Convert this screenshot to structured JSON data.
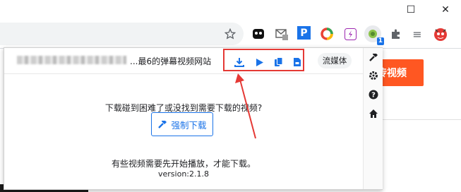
{
  "window": {
    "restore_glyph": "☐",
    "close_glyph": "✕"
  },
  "popup": {
    "title": "...最6的弹幕视频网站",
    "stream_label": "流媒体",
    "message": "下载碰到困难了或没找到需要下载的视频?",
    "force_download_label": "强制下载",
    "note": "有些视频需要先开始播放，才能下载。",
    "version": "version:2.1.8"
  },
  "page": {
    "orange_button_label": "传视频"
  },
  "extensions": {
    "badge_count": "1",
    "p_letter": "P",
    "reading_list_glyph": "≡"
  },
  "colors": {
    "accent": "#1a73e8",
    "highlight": "#e53935",
    "orange": "#ff5722"
  }
}
